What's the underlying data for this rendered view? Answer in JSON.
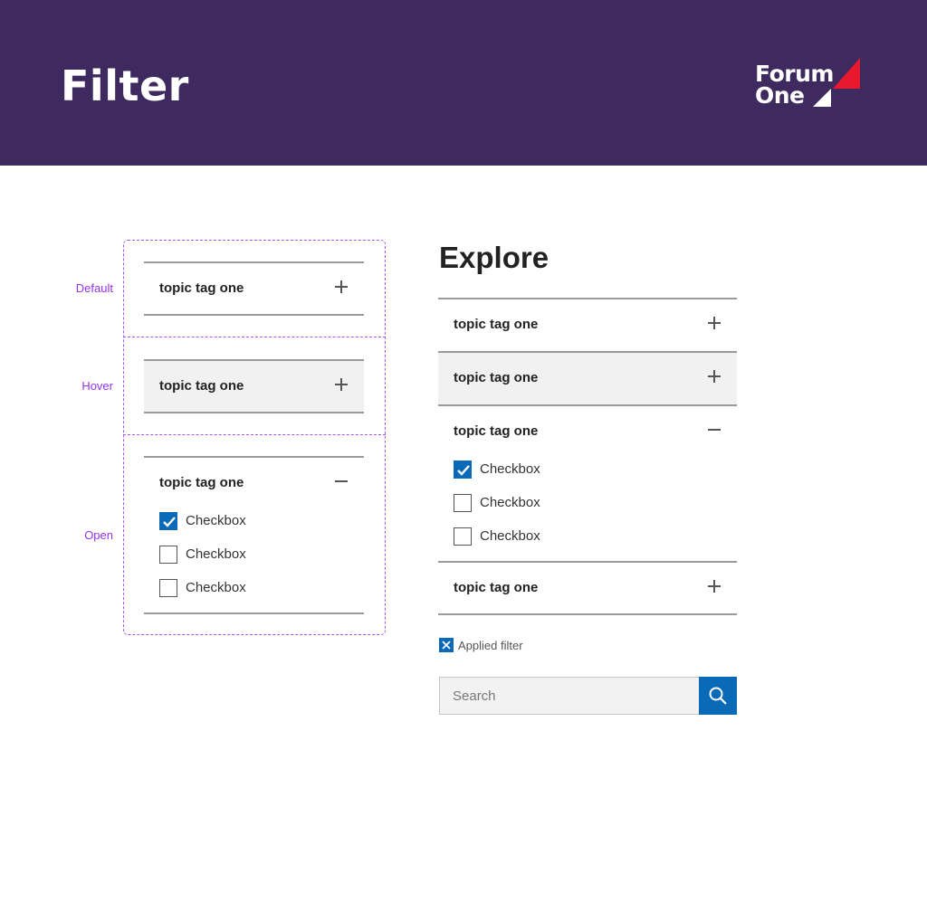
{
  "header": {
    "title": "Filter",
    "logo": {
      "line1": "Forum",
      "line2": "One"
    },
    "background_color": "#3e2a5e"
  },
  "states": {
    "labels": {
      "default": "Default",
      "hover": "Hover",
      "open": "Open"
    },
    "default": {
      "title": "topic tag one",
      "icon": "plus-icon"
    },
    "hover": {
      "title": "topic tag one",
      "icon": "plus-icon"
    },
    "open": {
      "title": "topic tag one",
      "icon": "minus-icon",
      "checkboxes": [
        {
          "label": "Checkbox",
          "checked": true
        },
        {
          "label": "Checkbox",
          "checked": false
        },
        {
          "label": "Checkbox",
          "checked": false
        }
      ]
    }
  },
  "explore": {
    "title": "Explore",
    "accordions": [
      {
        "title": "topic tag one",
        "state": "collapsed",
        "icon": "plus-icon"
      },
      {
        "title": "topic tag one",
        "state": "hover",
        "icon": "plus-icon"
      },
      {
        "title": "topic tag one",
        "state": "open",
        "icon": "minus-icon",
        "checkboxes": [
          {
            "label": "Checkbox",
            "checked": true
          },
          {
            "label": "Checkbox",
            "checked": false
          },
          {
            "label": "Checkbox",
            "checked": false
          }
        ]
      },
      {
        "title": "topic tag one",
        "state": "collapsed",
        "icon": "plus-icon"
      }
    ],
    "applied_filter": {
      "label": "Applied filter",
      "icon": "close-icon"
    },
    "search": {
      "placeholder": "Search",
      "value": "",
      "button_icon": "search-icon"
    }
  },
  "colors": {
    "accent_blue": "#0a6ab8",
    "state_frame": "#a855f7",
    "hover_background": "#f1f1f1",
    "logo_red": "#e8192c"
  }
}
